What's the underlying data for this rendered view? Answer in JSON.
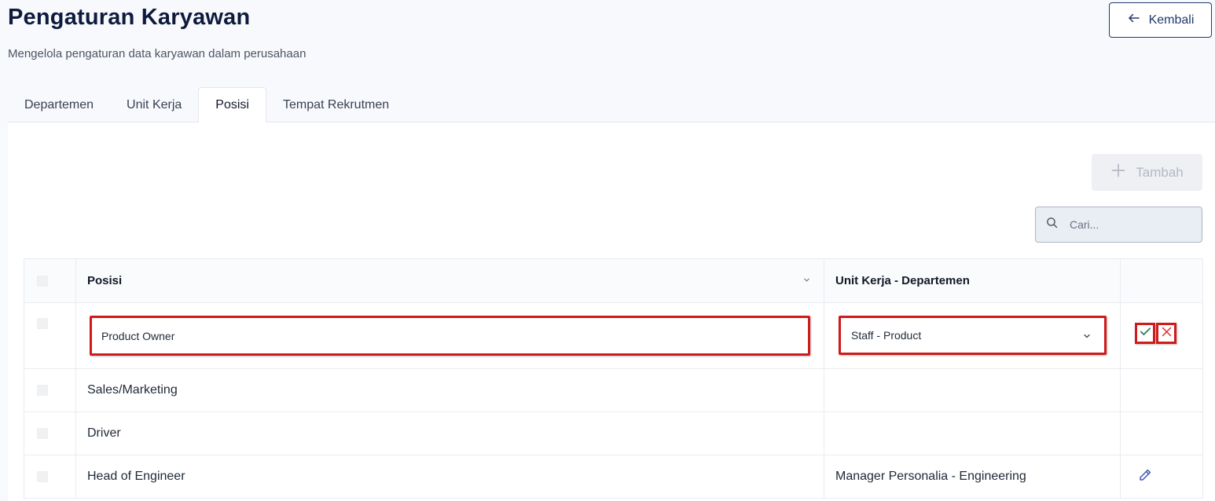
{
  "header": {
    "title": "Pengaturan Karyawan",
    "subtitle": "Mengelola pengaturan data karyawan dalam perusahaan",
    "back_label": "Kembali"
  },
  "tabs": [
    {
      "label": "Departemen",
      "active": false
    },
    {
      "label": "Unit Kerja",
      "active": false
    },
    {
      "label": "Posisi",
      "active": true
    },
    {
      "label": "Tempat Rekrutmen",
      "active": false
    }
  ],
  "toolbar": {
    "add_label": "Tambah",
    "search_placeholder": "Cari..."
  },
  "table": {
    "columns": [
      "Posisi",
      "Unit Kerja - Departemen"
    ],
    "editing_row": {
      "posisi_value": "Product Owner",
      "unit_selected": "Staff - Product"
    },
    "rows": [
      {
        "posisi": "Sales/Marketing",
        "unit": ""
      },
      {
        "posisi": "Driver",
        "unit": ""
      },
      {
        "posisi": "Head of Engineer",
        "unit": "Manager Personalia - Engineering"
      }
    ]
  },
  "colors": {
    "title": "#0f1b3d",
    "primary": "#1e3a6e",
    "highlight": "#d11a1a",
    "confirm": "#2e7d5b",
    "cancel": "#e53935",
    "edit_icon": "#3b5bb5"
  },
  "icons": {
    "back": "arrow-left-icon",
    "add": "plus-icon",
    "search": "search-icon",
    "sort": "chevron-down-icon",
    "confirm": "check-icon",
    "cancel": "close-icon",
    "edit": "pencil-icon"
  }
}
